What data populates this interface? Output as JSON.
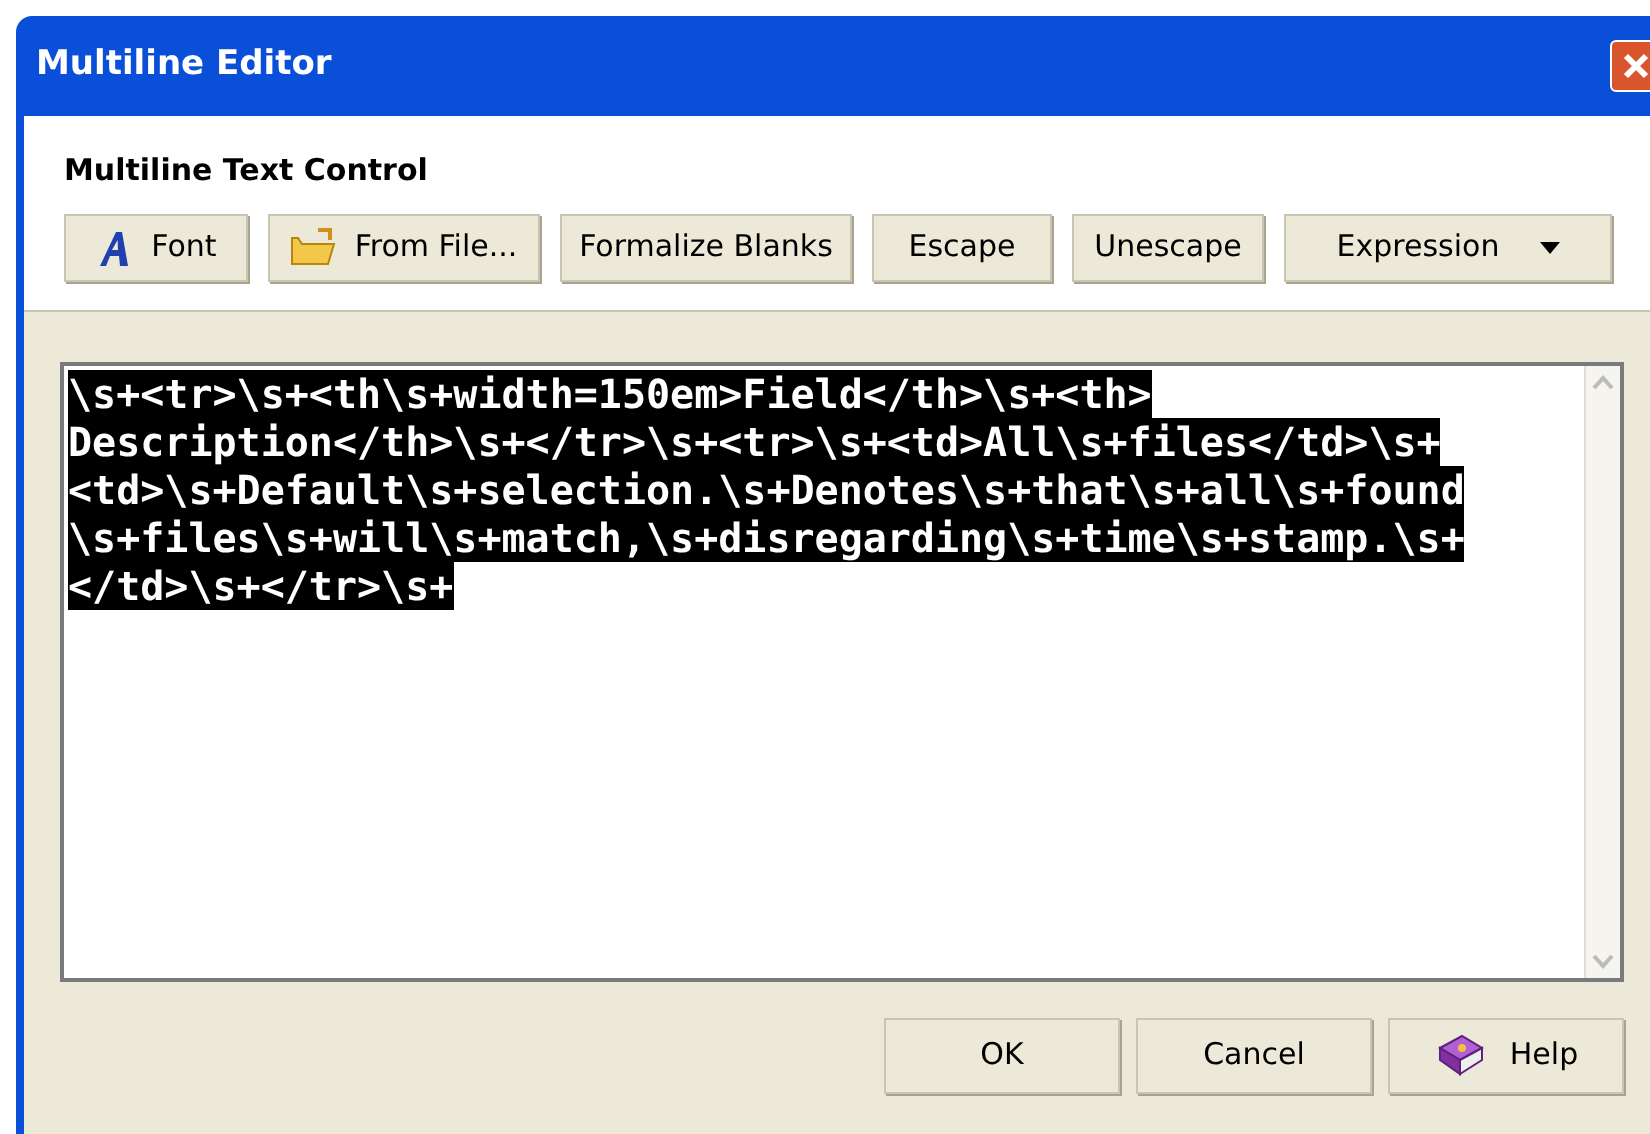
{
  "window": {
    "title": "Multiline Editor"
  },
  "section_title": "Multiline Text Control",
  "toolbar": [
    {
      "label": "Font",
      "kind": "font"
    },
    {
      "label": "From File...",
      "kind": "folder"
    },
    {
      "label": "Formalize Blanks",
      "kind": "plain"
    },
    {
      "label": "Escape",
      "kind": "plain"
    },
    {
      "label": "Unescape",
      "kind": "plain"
    },
    {
      "label": "Expression",
      "kind": "dropdown"
    }
  ],
  "editor": {
    "lines": [
      "\\s+<tr>\\s+<th\\s+width=150em>Field</th>\\s+<th>",
      "Description</th>\\s+</tr>\\s+<tr>\\s+<td>All\\s+files</td>\\s+",
      "<td>\\s+Default\\s+selection.\\s+Denotes\\s+that\\s+all\\s+found",
      "\\s+files\\s+will\\s+match,\\s+disregarding\\s+time\\s+stamp.\\s+",
      "</td>\\s+</tr>\\s+"
    ],
    "selected": true
  },
  "buttons": [
    {
      "label": "OK",
      "kind": "plain"
    },
    {
      "label": "Cancel",
      "kind": "plain"
    },
    {
      "label": "Help",
      "kind": "help"
    }
  ]
}
